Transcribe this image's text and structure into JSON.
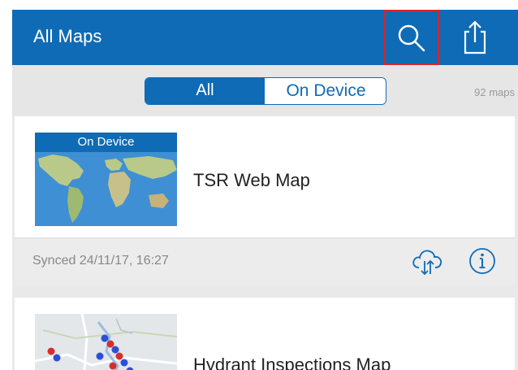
{
  "header": {
    "title": "All Maps"
  },
  "filter": {
    "all_label": "All",
    "on_device_label": "On Device",
    "count": "92 maps"
  },
  "maps": [
    {
      "title": "TSR Web Map",
      "badge": "On Device",
      "status": "Synced 24/11/17, 16:27"
    },
    {
      "title": "Hydrant Inspections Map"
    }
  ],
  "colors": {
    "header": "#0f6bb5",
    "highlight": "#d9232e",
    "background": "#e9e9e9"
  },
  "icons": {
    "search": "search-icon",
    "share": "share-icon",
    "sync": "cloud-sync-icon",
    "info": "info-icon"
  }
}
